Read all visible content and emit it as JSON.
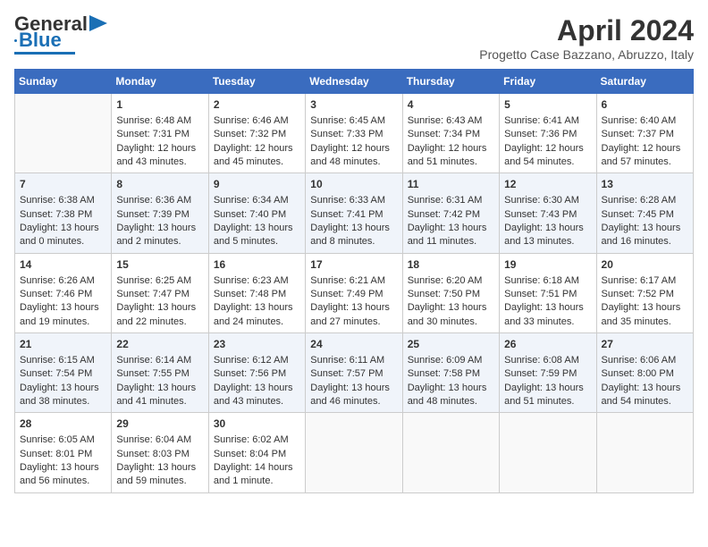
{
  "header": {
    "logo_line1": "General",
    "logo_line2": "Blue",
    "month": "April 2024",
    "location": "Progetto Case Bazzano, Abruzzo, Italy"
  },
  "days_of_week": [
    "Sunday",
    "Monday",
    "Tuesday",
    "Wednesday",
    "Thursday",
    "Friday",
    "Saturday"
  ],
  "weeks": [
    [
      {
        "num": "",
        "sunrise": "",
        "sunset": "",
        "daylight": ""
      },
      {
        "num": "1",
        "sunrise": "Sunrise: 6:48 AM",
        "sunset": "Sunset: 7:31 PM",
        "daylight": "Daylight: 12 hours and 43 minutes."
      },
      {
        "num": "2",
        "sunrise": "Sunrise: 6:46 AM",
        "sunset": "Sunset: 7:32 PM",
        "daylight": "Daylight: 12 hours and 45 minutes."
      },
      {
        "num": "3",
        "sunrise": "Sunrise: 6:45 AM",
        "sunset": "Sunset: 7:33 PM",
        "daylight": "Daylight: 12 hours and 48 minutes."
      },
      {
        "num": "4",
        "sunrise": "Sunrise: 6:43 AM",
        "sunset": "Sunset: 7:34 PM",
        "daylight": "Daylight: 12 hours and 51 minutes."
      },
      {
        "num": "5",
        "sunrise": "Sunrise: 6:41 AM",
        "sunset": "Sunset: 7:36 PM",
        "daylight": "Daylight: 12 hours and 54 minutes."
      },
      {
        "num": "6",
        "sunrise": "Sunrise: 6:40 AM",
        "sunset": "Sunset: 7:37 PM",
        "daylight": "Daylight: 12 hours and 57 minutes."
      }
    ],
    [
      {
        "num": "7",
        "sunrise": "Sunrise: 6:38 AM",
        "sunset": "Sunset: 7:38 PM",
        "daylight": "Daylight: 13 hours and 0 minutes."
      },
      {
        "num": "8",
        "sunrise": "Sunrise: 6:36 AM",
        "sunset": "Sunset: 7:39 PM",
        "daylight": "Daylight: 13 hours and 2 minutes."
      },
      {
        "num": "9",
        "sunrise": "Sunrise: 6:34 AM",
        "sunset": "Sunset: 7:40 PM",
        "daylight": "Daylight: 13 hours and 5 minutes."
      },
      {
        "num": "10",
        "sunrise": "Sunrise: 6:33 AM",
        "sunset": "Sunset: 7:41 PM",
        "daylight": "Daylight: 13 hours and 8 minutes."
      },
      {
        "num": "11",
        "sunrise": "Sunrise: 6:31 AM",
        "sunset": "Sunset: 7:42 PM",
        "daylight": "Daylight: 13 hours and 11 minutes."
      },
      {
        "num": "12",
        "sunrise": "Sunrise: 6:30 AM",
        "sunset": "Sunset: 7:43 PM",
        "daylight": "Daylight: 13 hours and 13 minutes."
      },
      {
        "num": "13",
        "sunrise": "Sunrise: 6:28 AM",
        "sunset": "Sunset: 7:45 PM",
        "daylight": "Daylight: 13 hours and 16 minutes."
      }
    ],
    [
      {
        "num": "14",
        "sunrise": "Sunrise: 6:26 AM",
        "sunset": "Sunset: 7:46 PM",
        "daylight": "Daylight: 13 hours and 19 minutes."
      },
      {
        "num": "15",
        "sunrise": "Sunrise: 6:25 AM",
        "sunset": "Sunset: 7:47 PM",
        "daylight": "Daylight: 13 hours and 22 minutes."
      },
      {
        "num": "16",
        "sunrise": "Sunrise: 6:23 AM",
        "sunset": "Sunset: 7:48 PM",
        "daylight": "Daylight: 13 hours and 24 minutes."
      },
      {
        "num": "17",
        "sunrise": "Sunrise: 6:21 AM",
        "sunset": "Sunset: 7:49 PM",
        "daylight": "Daylight: 13 hours and 27 minutes."
      },
      {
        "num": "18",
        "sunrise": "Sunrise: 6:20 AM",
        "sunset": "Sunset: 7:50 PM",
        "daylight": "Daylight: 13 hours and 30 minutes."
      },
      {
        "num": "19",
        "sunrise": "Sunrise: 6:18 AM",
        "sunset": "Sunset: 7:51 PM",
        "daylight": "Daylight: 13 hours and 33 minutes."
      },
      {
        "num": "20",
        "sunrise": "Sunrise: 6:17 AM",
        "sunset": "Sunset: 7:52 PM",
        "daylight": "Daylight: 13 hours and 35 minutes."
      }
    ],
    [
      {
        "num": "21",
        "sunrise": "Sunrise: 6:15 AM",
        "sunset": "Sunset: 7:54 PM",
        "daylight": "Daylight: 13 hours and 38 minutes."
      },
      {
        "num": "22",
        "sunrise": "Sunrise: 6:14 AM",
        "sunset": "Sunset: 7:55 PM",
        "daylight": "Daylight: 13 hours and 41 minutes."
      },
      {
        "num": "23",
        "sunrise": "Sunrise: 6:12 AM",
        "sunset": "Sunset: 7:56 PM",
        "daylight": "Daylight: 13 hours and 43 minutes."
      },
      {
        "num": "24",
        "sunrise": "Sunrise: 6:11 AM",
        "sunset": "Sunset: 7:57 PM",
        "daylight": "Daylight: 13 hours and 46 minutes."
      },
      {
        "num": "25",
        "sunrise": "Sunrise: 6:09 AM",
        "sunset": "Sunset: 7:58 PM",
        "daylight": "Daylight: 13 hours and 48 minutes."
      },
      {
        "num": "26",
        "sunrise": "Sunrise: 6:08 AM",
        "sunset": "Sunset: 7:59 PM",
        "daylight": "Daylight: 13 hours and 51 minutes."
      },
      {
        "num": "27",
        "sunrise": "Sunrise: 6:06 AM",
        "sunset": "Sunset: 8:00 PM",
        "daylight": "Daylight: 13 hours and 54 minutes."
      }
    ],
    [
      {
        "num": "28",
        "sunrise": "Sunrise: 6:05 AM",
        "sunset": "Sunset: 8:01 PM",
        "daylight": "Daylight: 13 hours and 56 minutes."
      },
      {
        "num": "29",
        "sunrise": "Sunrise: 6:04 AM",
        "sunset": "Sunset: 8:03 PM",
        "daylight": "Daylight: 13 hours and 59 minutes."
      },
      {
        "num": "30",
        "sunrise": "Sunrise: 6:02 AM",
        "sunset": "Sunset: 8:04 PM",
        "daylight": "Daylight: 14 hours and 1 minute."
      },
      {
        "num": "",
        "sunrise": "",
        "sunset": "",
        "daylight": ""
      },
      {
        "num": "",
        "sunrise": "",
        "sunset": "",
        "daylight": ""
      },
      {
        "num": "",
        "sunrise": "",
        "sunset": "",
        "daylight": ""
      },
      {
        "num": "",
        "sunrise": "",
        "sunset": "",
        "daylight": ""
      }
    ]
  ]
}
